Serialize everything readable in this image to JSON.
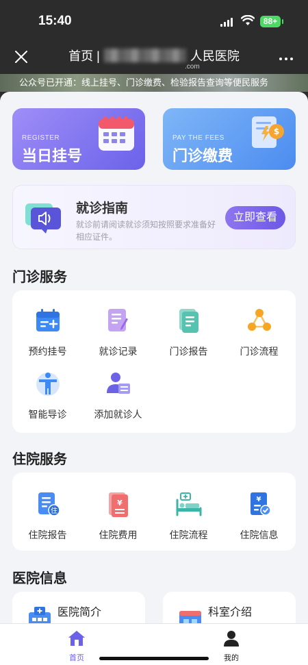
{
  "status_bar": {
    "time": "15:40",
    "battery": "88+"
  },
  "nav": {
    "title_left": "首页 |",
    "title_right": "人民医院",
    "subtitle": ".com"
  },
  "notice": "公众号已开通：线上挂号、门诊缴费、检验报告查询等便民服务",
  "quick_cards": [
    {
      "en": "REGISTER",
      "cn": "当日挂号"
    },
    {
      "en": "PAY THE FEES",
      "cn": "门诊缴费"
    }
  ],
  "guide": {
    "title": "就诊指南",
    "desc": "就诊前请阅读就诊须知按照要求准备好相应证件。",
    "button": "立即查看"
  },
  "outpatient": {
    "title": "门诊服务",
    "items": [
      {
        "label": "预约挂号",
        "icon": "calendar-icon"
      },
      {
        "label": "就诊记录",
        "icon": "record-icon"
      },
      {
        "label": "门诊报告",
        "icon": "report-icon"
      },
      {
        "label": "门诊流程",
        "icon": "flow-icon"
      },
      {
        "label": "智能导诊",
        "icon": "body-guide-icon"
      },
      {
        "label": "添加就诊人",
        "icon": "add-patient-icon"
      }
    ]
  },
  "inpatient": {
    "title": "住院服务",
    "items": [
      {
        "label": "住院报告",
        "icon": "inpatient-report-icon"
      },
      {
        "label": "住院费用",
        "icon": "inpatient-fee-icon"
      },
      {
        "label": "住院流程",
        "icon": "bed-icon"
      },
      {
        "label": "住院信息",
        "icon": "inpatient-info-icon"
      }
    ]
  },
  "hospital_info": {
    "title": "医院信息",
    "cards": [
      {
        "label": "医院简介",
        "icon": "hospital-icon"
      },
      {
        "label": "科室介绍",
        "icon": "department-icon"
      }
    ]
  },
  "tabs": [
    {
      "label": "首页",
      "icon": "home-icon",
      "active": true
    },
    {
      "label": "我的",
      "icon": "user-icon",
      "active": false
    }
  ],
  "colors": {
    "accent": "#6b62e9",
    "tab_active": "#6b62e9"
  }
}
